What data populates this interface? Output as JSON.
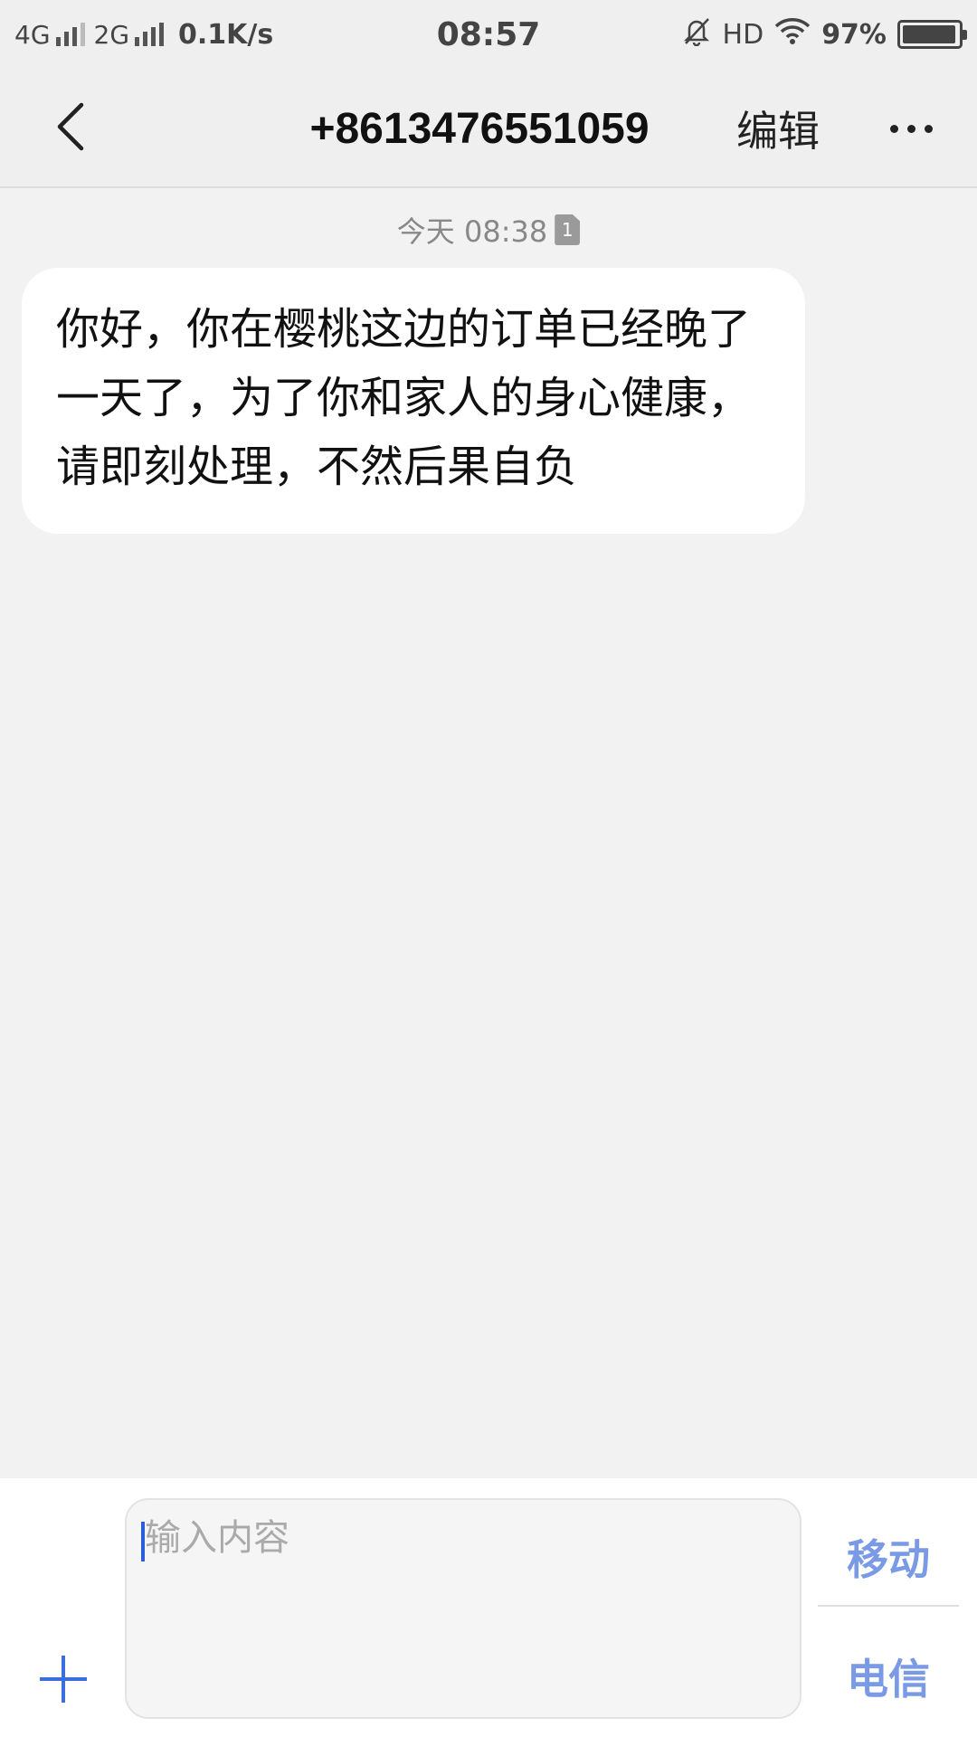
{
  "status_bar": {
    "network1": "4G",
    "network2": "2G",
    "speed": "0.1K/s",
    "time": "08:57",
    "hd": "HD",
    "battery": "97%",
    "battery_level": 0.97
  },
  "header": {
    "back_icon": "chevron-left-icon",
    "title": "+8613476551059",
    "edit_label": "编辑",
    "more_icon": "more-dots-icon"
  },
  "conversation": {
    "messages": [
      {
        "time": "今天 08:38",
        "sim_badge": "1",
        "text": "你好，你在樱桃这边的订单已经晚了一天了，为了你和家人的身心健康，请即刻处理，不然后果自负"
      }
    ]
  },
  "composer": {
    "placeholder": "输入内容",
    "value": "",
    "add_icon": "plus-icon",
    "send_sim1_label": "移动",
    "send_sim2_label": "电信",
    "accent_color": "#7a9ae6"
  }
}
